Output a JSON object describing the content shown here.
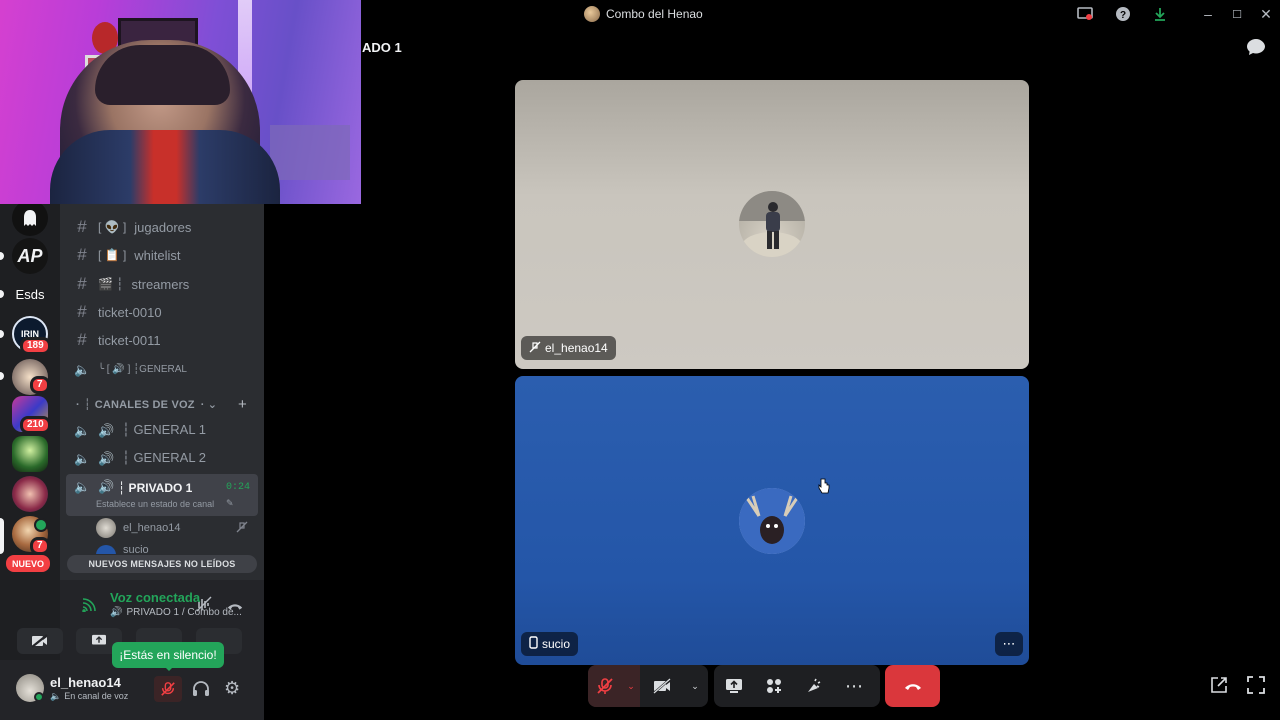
{
  "window": {
    "title": "Combo del Henao"
  },
  "header": {
    "channel_title": "ADO 1"
  },
  "servers": [
    {
      "name": "server-ghost"
    },
    {
      "name": "server-ap",
      "text": "AP"
    },
    {
      "name": "server-esds",
      "text": "Esds"
    },
    {
      "name": "server-irin",
      "text": "IRIN",
      "badge": "189"
    },
    {
      "name": "server-anime",
      "badge": "7"
    },
    {
      "name": "server-colorful",
      "badge": "210"
    },
    {
      "name": "server-skull"
    },
    {
      "name": "server-people"
    },
    {
      "name": "server-current",
      "badge": "7"
    }
  ],
  "new_badge": "NUEVO",
  "channels": {
    "text": [
      {
        "prefix": "[ 👽 ]",
        "label": "jugadores"
      },
      {
        "prefix": "[ 📋 ]",
        "label": "whitelist"
      },
      {
        "prefix": "🎬 ┆",
        "label": "streamers"
      },
      {
        "prefix": "",
        "label": "ticket-0010"
      },
      {
        "prefix": "",
        "label": "ticket-0011"
      }
    ],
    "general_text": "╰ [ 🔊 ] ┆GENERAL",
    "voice_category": "CANALES DE VOZ",
    "voice": [
      {
        "label": "┆ GENERAL 1"
      },
      {
        "label": "┆ GENERAL 2"
      },
      {
        "label": "┆ PRIVADO 1",
        "timer": "0:24",
        "status": "Establece un estado de canal"
      }
    ],
    "voice_users": [
      "el_henao14",
      "sucio"
    ]
  },
  "new_messages": "NUEVOS MENSAJES NO LEÍDOS",
  "voice_panel": {
    "status": "Voz conectada",
    "location": "PRIVADO 1 / Combo de..."
  },
  "tooltip": "¡Estás en silencio!",
  "user_panel": {
    "username": "el_henao14",
    "status": "En canal de voz"
  },
  "tiles": [
    {
      "label": "el_henao14",
      "bg": "#c7c3bc"
    },
    {
      "label": "sucio",
      "bg": "#2456a8"
    }
  ],
  "colors": {
    "accent_green": "#23a55a",
    "danger": "#da373c",
    "blurple": "#5865f2"
  }
}
